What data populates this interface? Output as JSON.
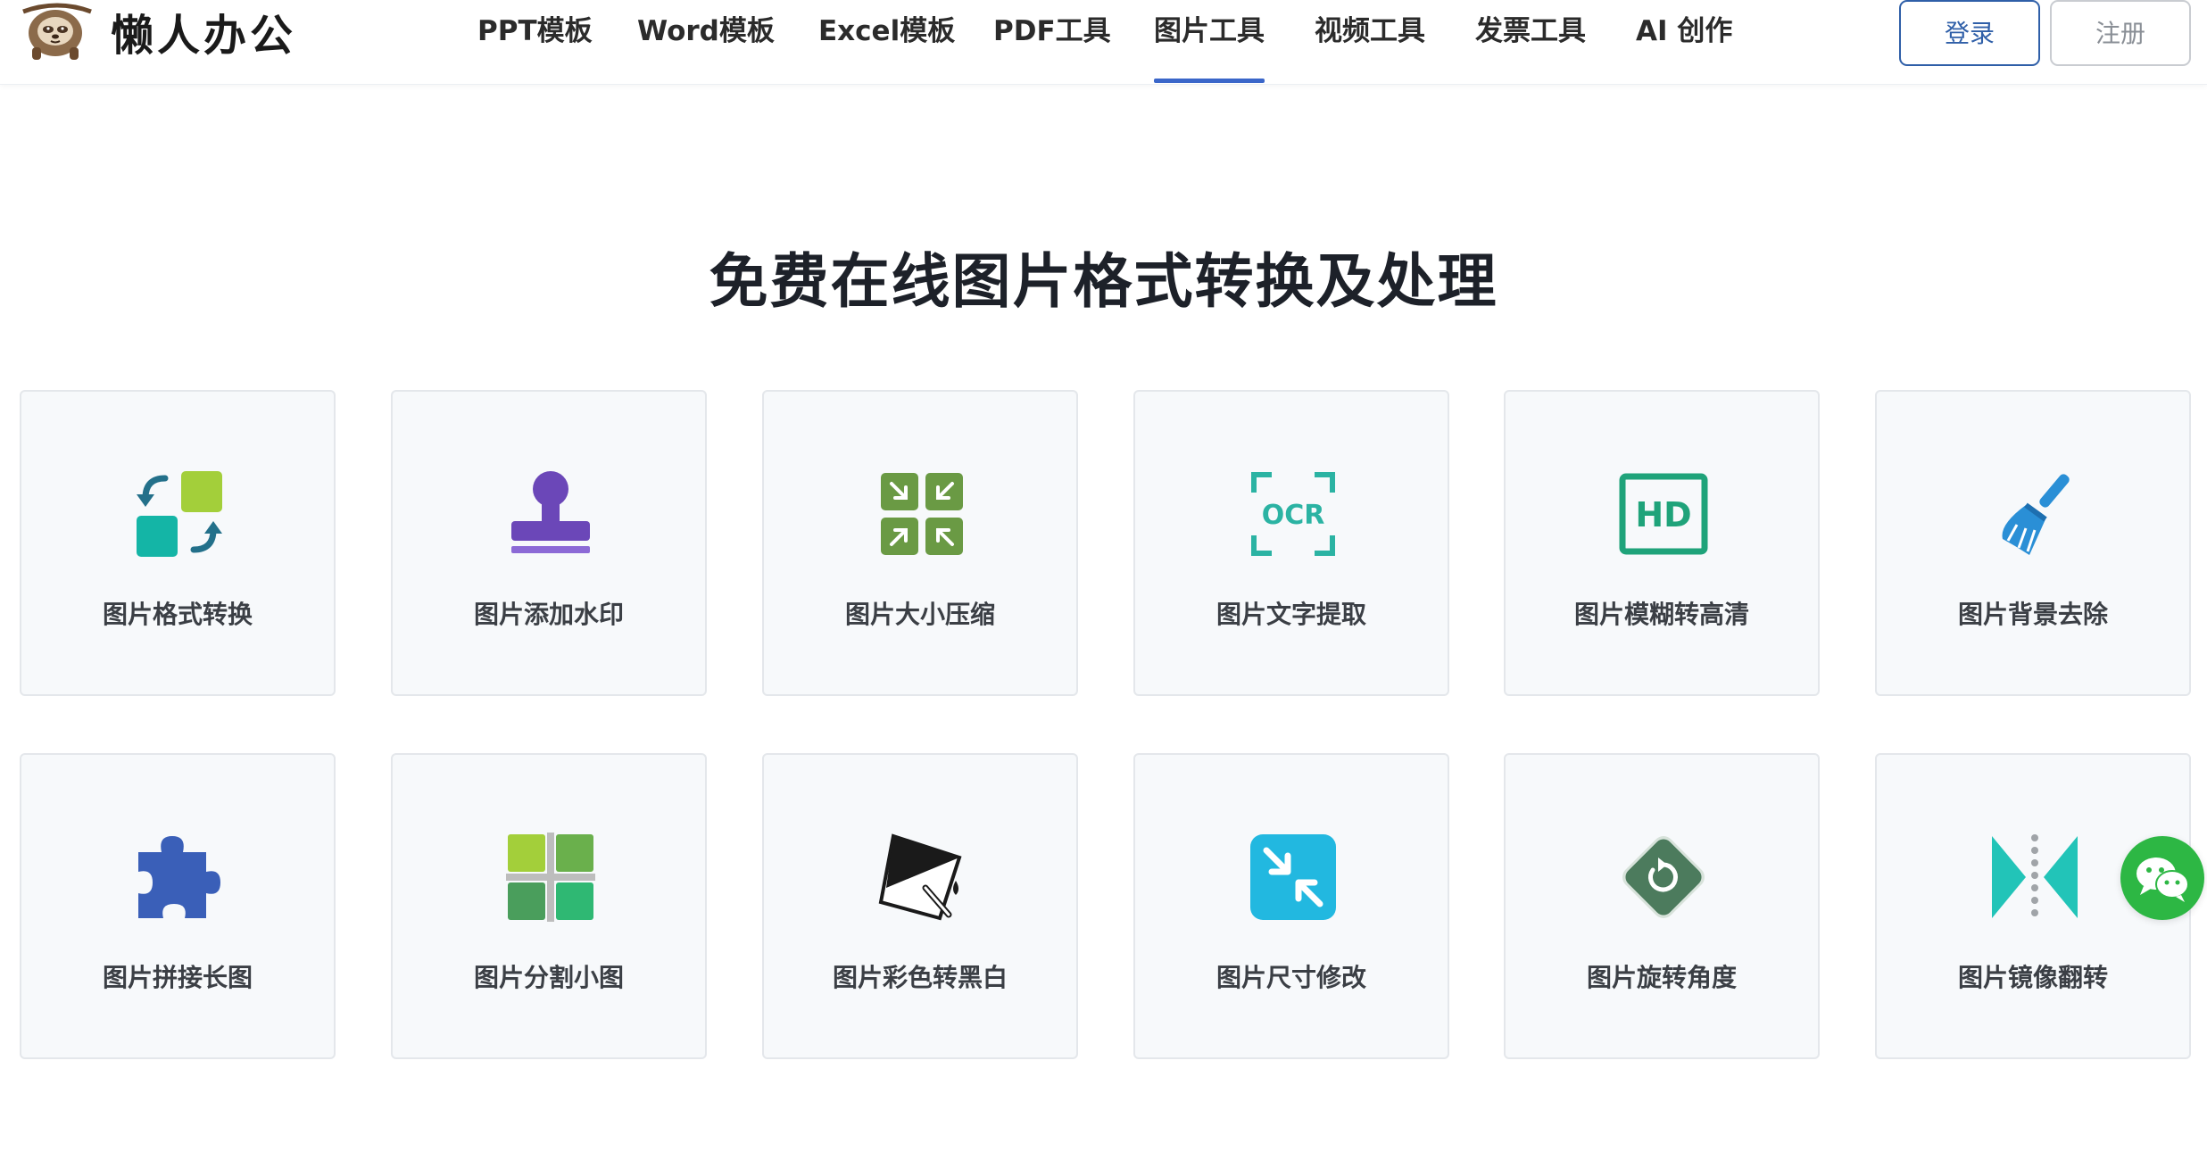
{
  "brand": {
    "name": "懒人办公"
  },
  "nav": {
    "items": [
      {
        "label": "PPT模板"
      },
      {
        "label": "Word模板"
      },
      {
        "label": "Excel模板"
      },
      {
        "label": "PDF工具"
      },
      {
        "label": "图片工具",
        "active": true
      },
      {
        "label": "视频工具"
      },
      {
        "label": "发票工具"
      },
      {
        "label": "AI 创作"
      }
    ]
  },
  "auth": {
    "login_label": "登录",
    "register_label": "注册"
  },
  "main": {
    "title": "免费在线图片格式转换及处理",
    "tools": [
      {
        "label": "图片格式转换",
        "icon": "format-convert-icon"
      },
      {
        "label": "图片添加水印",
        "icon": "stamp-icon"
      },
      {
        "label": "图片大小压缩",
        "icon": "compress-icon"
      },
      {
        "label": "图片文字提取",
        "icon": "ocr-icon"
      },
      {
        "label": "图片模糊转高清",
        "icon": "hd-icon"
      },
      {
        "label": "图片背景去除",
        "icon": "broom-icon"
      },
      {
        "label": "图片拼接长图",
        "icon": "puzzle-icon"
      },
      {
        "label": "图片分割小图",
        "icon": "grid-split-icon"
      },
      {
        "label": "图片彩色转黑白",
        "icon": "paint-bucket-icon"
      },
      {
        "label": "图片尺寸修改",
        "icon": "resize-icon"
      },
      {
        "label": "图片旋转角度",
        "icon": "rotate-icon"
      },
      {
        "label": "图片镜像翻转",
        "icon": "mirror-flip-icon"
      }
    ]
  },
  "floating": {
    "icon": "wechat-icon"
  },
  "colors": {
    "accent": "#3a66c9",
    "login_border": "#2f5fa8",
    "card_bg": "#f7f9fb",
    "wechat_green": "#2db744"
  }
}
